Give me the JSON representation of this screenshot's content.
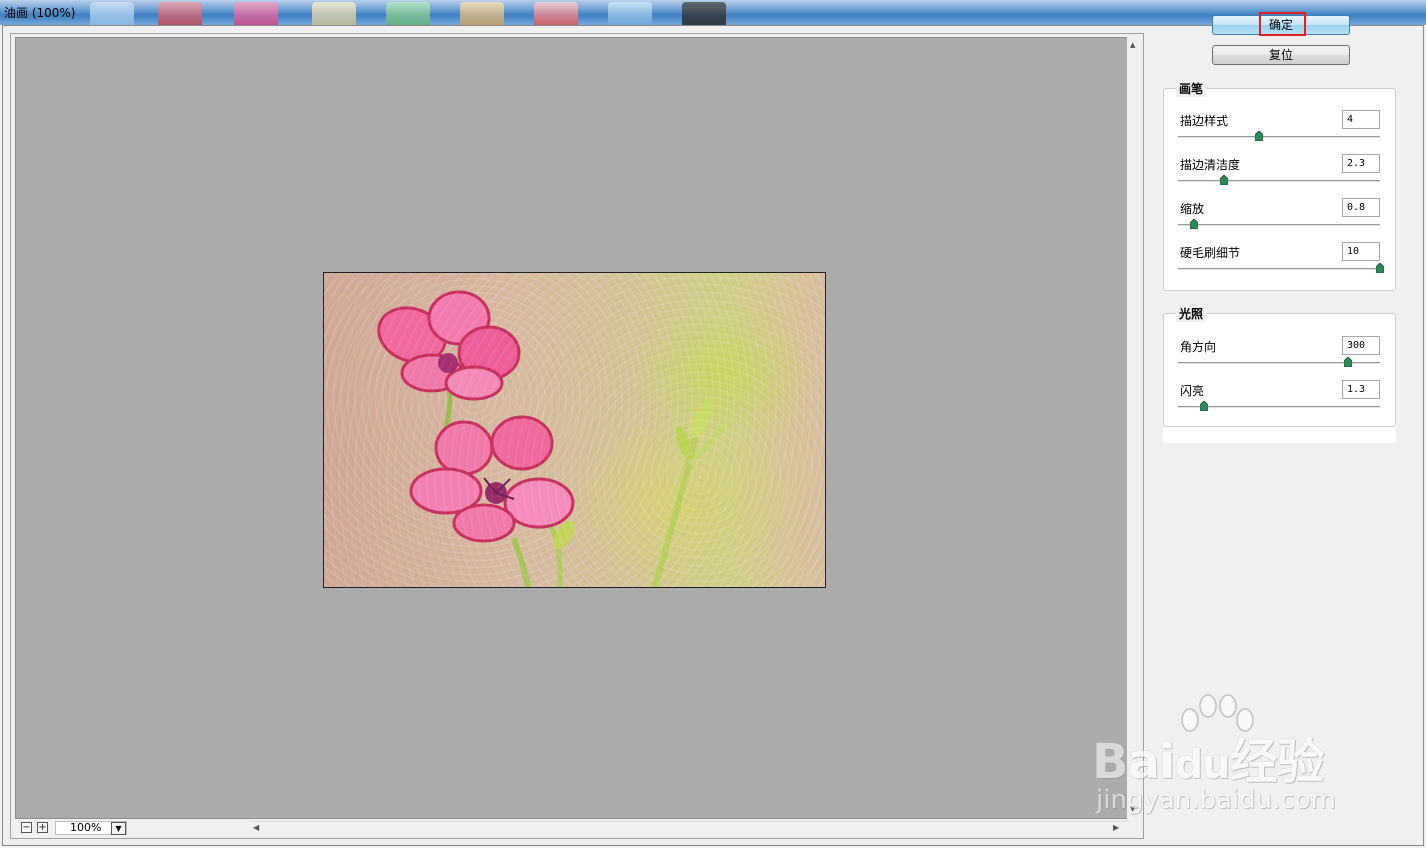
{
  "window": {
    "title": "油画 (100%)"
  },
  "buttons": {
    "ok": "确定",
    "reset": "复位"
  },
  "brush": {
    "title": "画笔",
    "params": [
      {
        "label": "描边样式",
        "value": "4",
        "level": 0.4
      },
      {
        "label": "描边清洁度",
        "value": "2.3",
        "level": 0.23
      },
      {
        "label": "缩放",
        "value": "0.8",
        "level": 0.08
      },
      {
        "label": "硬毛刷细节",
        "value": "10",
        "level": 1.0
      }
    ]
  },
  "lighting": {
    "title": "光照",
    "params": [
      {
        "label": "角方向",
        "value": "300",
        "level": 0.84
      },
      {
        "label": "闪亮",
        "value": "1.3",
        "level": 0.13
      }
    ]
  },
  "zoom": {
    "value": "100%",
    "minus": "−",
    "plus": "+"
  },
  "watermark": {
    "brand": "Bai",
    "brand_cn": "经验",
    "url": "jingyan.baidu.com"
  },
  "colors": {
    "highlight": "#e02020",
    "slider_thumb": "#2e8b57",
    "preview_bg": "#ababab"
  }
}
